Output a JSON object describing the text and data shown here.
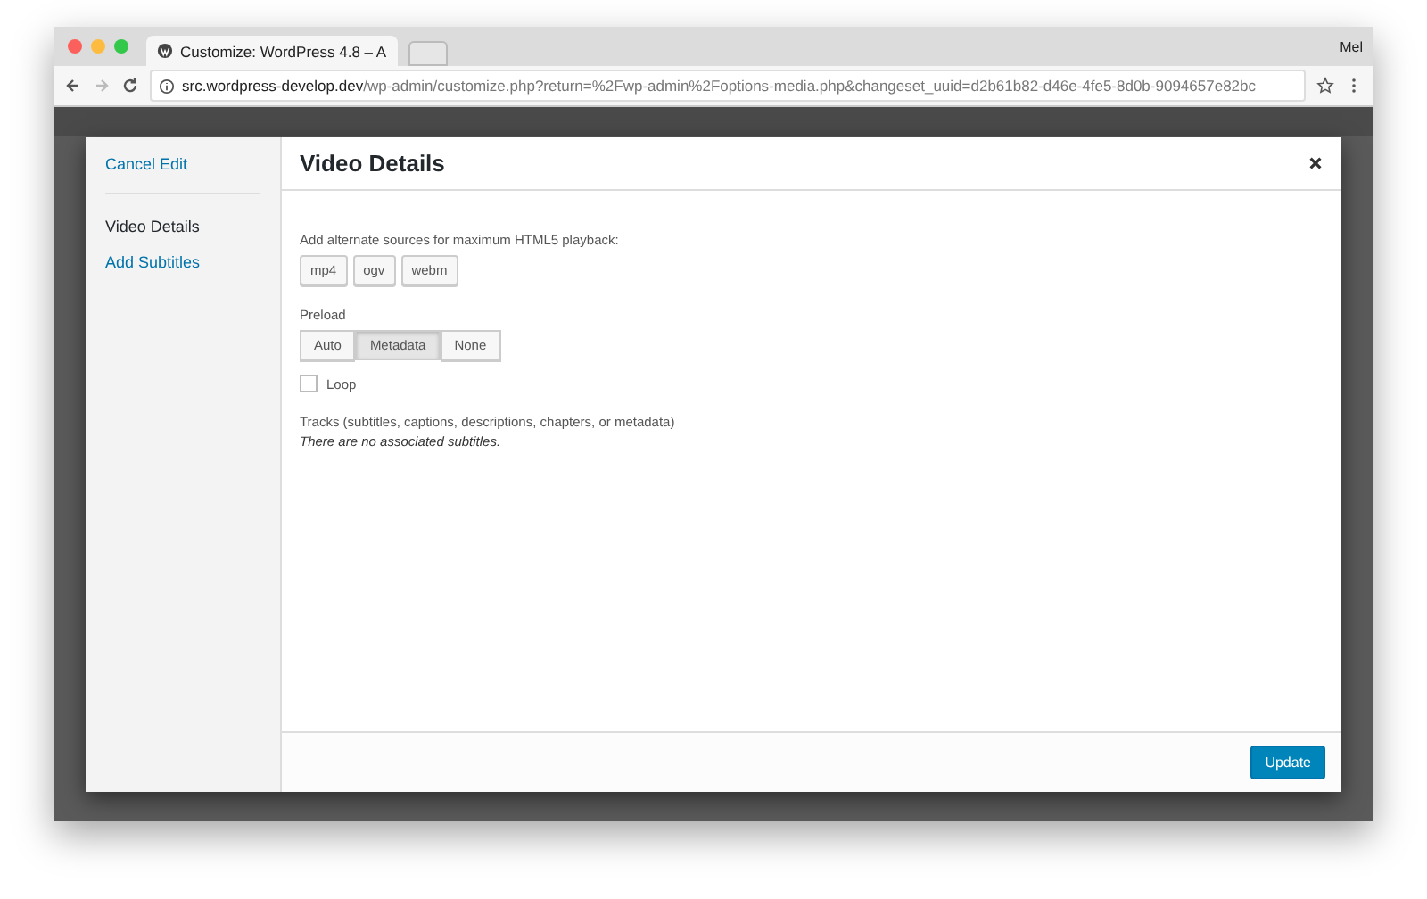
{
  "browser": {
    "tab_title": "Customize: WordPress 4.8 – A",
    "user": "Mel",
    "url_host": "src.wordpress-develop.dev",
    "url_path": "/wp-admin/customize.php?return=%2Fwp-admin%2Foptions-media.php&changeset_uuid=d2b61b82-d46e-4fe5-8d0b-9094657e82bc"
  },
  "sidebar": {
    "cancel": "Cancel Edit",
    "items": [
      {
        "label": "Video Details",
        "selected": true
      },
      {
        "label": "Add Subtitles",
        "selected": false
      }
    ]
  },
  "modal": {
    "title": "Video Details",
    "sources_label": "Add alternate sources for maximum HTML5 playback:",
    "sources": [
      "mp4",
      "ogv",
      "webm"
    ],
    "preload_label": "Preload",
    "preload_options": [
      {
        "label": "Auto",
        "selected": false
      },
      {
        "label": "Metadata",
        "selected": true
      },
      {
        "label": "None",
        "selected": false
      }
    ],
    "loop": {
      "label": "Loop",
      "checked": false
    },
    "tracks_label": "Tracks (subtitles, captions, descriptions, chapters, or metadata)",
    "tracks_note": "There are no associated subtitles.",
    "update_button": "Update"
  }
}
